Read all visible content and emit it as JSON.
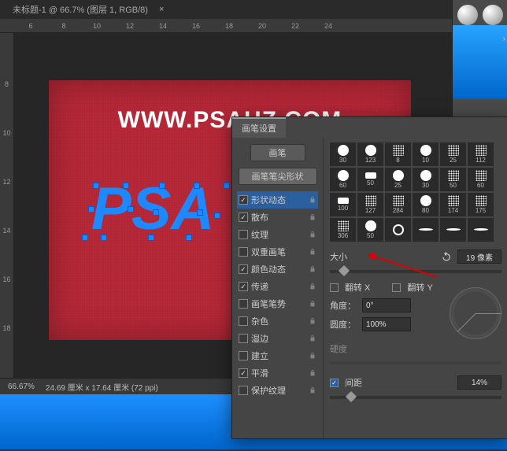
{
  "tab": {
    "title": "未标题-1 @ 66.7% (图层 1, RGB/8)",
    "close": "×"
  },
  "ruler_top": [
    "6",
    "8",
    "10",
    "12",
    "14",
    "16",
    "18",
    "20",
    "22",
    "24"
  ],
  "ruler_left": [
    "8",
    "10",
    "12",
    "14",
    "16",
    "18"
  ],
  "canvas": {
    "heading": "WWW.PSAHZ.COM",
    "vector_text": "PSA"
  },
  "status": {
    "zoom": "66.67%",
    "dims": "24.69 厘米 x 17.64 厘米 (72 ppi)"
  },
  "panel": {
    "title": "画笔设置",
    "brush_btn": "画笔",
    "tip_btn": "画笔笔尖形状",
    "options": [
      {
        "label": "形状动态",
        "checked": true,
        "locked": true
      },
      {
        "label": "散布",
        "checked": true,
        "locked": true
      },
      {
        "label": "纹理",
        "checked": false,
        "locked": true
      },
      {
        "label": "双重画笔",
        "checked": false,
        "locked": true
      },
      {
        "label": "颜色动态",
        "checked": true,
        "locked": true
      },
      {
        "label": "传递",
        "checked": true,
        "locked": true
      },
      {
        "label": "画笔笔势",
        "checked": false,
        "locked": true
      },
      {
        "label": "杂色",
        "checked": false,
        "locked": true
      },
      {
        "label": "湿边",
        "checked": false,
        "locked": true
      },
      {
        "label": "建立",
        "checked": false,
        "locked": true
      },
      {
        "label": "平滑",
        "checked": true,
        "locked": true
      },
      {
        "label": "保护纹理",
        "checked": false,
        "locked": true
      }
    ],
    "thumbs": [
      "30",
      "123",
      "8",
      "10",
      "25",
      "112",
      "60",
      "50",
      "25",
      "30",
      "50",
      "60",
      "100",
      "127",
      "284",
      "80",
      "174",
      "175",
      "306",
      "50",
      "",
      "",
      "",
      "",
      "",
      "",
      "",
      ""
    ],
    "size_label": "大小",
    "size_value": "19 像素",
    "flip_x": "翻转 X",
    "flip_y": "翻转 Y",
    "angle_label": "角度：",
    "angle_value": "0°",
    "round_label": "圆度：",
    "round_value": "100%",
    "hardness_label": "硬度",
    "spacing_label": "间距",
    "spacing_checked": true,
    "spacing_value": "14%"
  }
}
